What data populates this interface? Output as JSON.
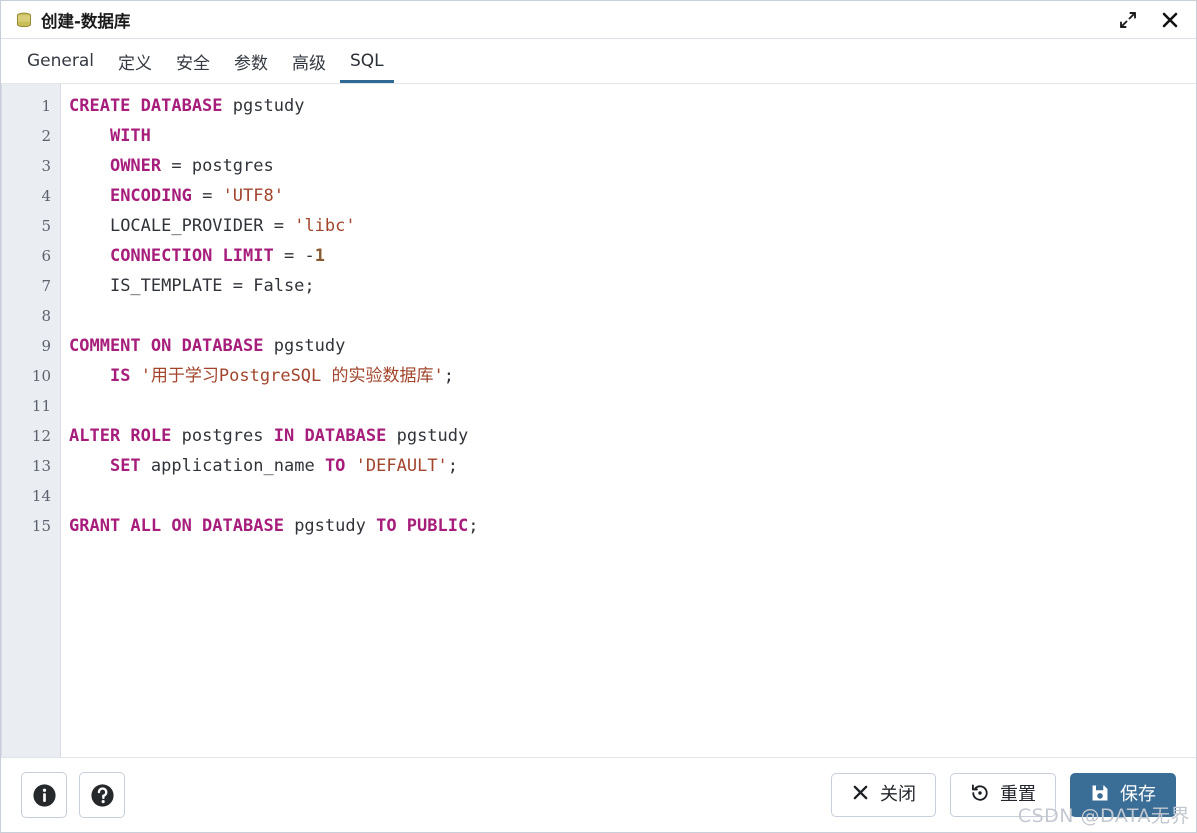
{
  "window": {
    "title": "创建-数据库",
    "icon": "database-icon",
    "maximize_icon": "expand-diagonal-icon",
    "close_icon": "close-x-icon"
  },
  "tabs": [
    {
      "label": "General",
      "active": false
    },
    {
      "label": "定义",
      "active": false
    },
    {
      "label": "安全",
      "active": false
    },
    {
      "label": "参数",
      "active": false
    },
    {
      "label": "高级",
      "active": false
    },
    {
      "label": "SQL",
      "active": true
    }
  ],
  "editor": {
    "language": "sql",
    "line_count": 15,
    "line_numbers": [
      "1",
      "2",
      "3",
      "4",
      "5",
      "6",
      "7",
      "8",
      "9",
      "10",
      "11",
      "12",
      "13",
      "14",
      "15"
    ],
    "plain_text": "CREATE DATABASE pgstudy\n    WITH\n    OWNER = postgres\n    ENCODING = 'UTF8'\n    LOCALE_PROVIDER = 'libc'\n    CONNECTION LIMIT = -1\n    IS_TEMPLATE = False;\n\nCOMMENT ON DATABASE pgstudy\n    IS '用于学习PostgreSQL 的实验数据库';\n\nALTER ROLE postgres IN DATABASE pgstudy\n    SET application_name TO 'DEFAULT';\n\nGRANT ALL ON DATABASE pgstudy TO PUBLIC;",
    "lines": [
      {
        "n": "1",
        "tokens": [
          {
            "t": "CREATE DATABASE",
            "c": "kw"
          },
          {
            "t": " ",
            "c": "op"
          },
          {
            "t": "pgstudy",
            "c": "id"
          }
        ]
      },
      {
        "n": "2",
        "tokens": [
          {
            "t": "    ",
            "c": "op"
          },
          {
            "t": "WITH",
            "c": "kw"
          }
        ]
      },
      {
        "n": "3",
        "tokens": [
          {
            "t": "    ",
            "c": "op"
          },
          {
            "t": "OWNER",
            "c": "kw"
          },
          {
            "t": " = ",
            "c": "op"
          },
          {
            "t": "postgres",
            "c": "id"
          }
        ]
      },
      {
        "n": "4",
        "tokens": [
          {
            "t": "    ",
            "c": "op"
          },
          {
            "t": "ENCODING",
            "c": "kw"
          },
          {
            "t": " = ",
            "c": "op"
          },
          {
            "t": "'UTF8'",
            "c": "str"
          }
        ]
      },
      {
        "n": "5",
        "tokens": [
          {
            "t": "    ",
            "c": "op"
          },
          {
            "t": "LOCALE_PROVIDER",
            "c": "id"
          },
          {
            "t": " = ",
            "c": "op"
          },
          {
            "t": "'libc'",
            "c": "str"
          }
        ]
      },
      {
        "n": "6",
        "tokens": [
          {
            "t": "    ",
            "c": "op"
          },
          {
            "t": "CONNECTION LIMIT",
            "c": "kw"
          },
          {
            "t": " = ",
            "c": "op"
          },
          {
            "t": "-",
            "c": "op"
          },
          {
            "t": "1",
            "c": "num"
          }
        ]
      },
      {
        "n": "7",
        "tokens": [
          {
            "t": "    ",
            "c": "op"
          },
          {
            "t": "IS_TEMPLATE = False;",
            "c": "id"
          }
        ]
      },
      {
        "n": "8",
        "tokens": [
          {
            "t": "",
            "c": "op"
          }
        ]
      },
      {
        "n": "9",
        "tokens": [
          {
            "t": "COMMENT ON DATABASE",
            "c": "kw"
          },
          {
            "t": " ",
            "c": "op"
          },
          {
            "t": "pgstudy",
            "c": "id"
          }
        ]
      },
      {
        "n": "10",
        "tokens": [
          {
            "t": "    ",
            "c": "op"
          },
          {
            "t": "IS",
            "c": "kw"
          },
          {
            "t": " ",
            "c": "op"
          },
          {
            "t": "'用于学习PostgreSQL 的实验数据库'",
            "c": "str"
          },
          {
            "t": ";",
            "c": "op"
          }
        ]
      },
      {
        "n": "11",
        "tokens": [
          {
            "t": "",
            "c": "op"
          }
        ]
      },
      {
        "n": "12",
        "tokens": [
          {
            "t": "ALTER ROLE",
            "c": "kw"
          },
          {
            "t": " ",
            "c": "op"
          },
          {
            "t": "postgres",
            "c": "id"
          },
          {
            "t": " ",
            "c": "op"
          },
          {
            "t": "IN DATABASE",
            "c": "kw"
          },
          {
            "t": " ",
            "c": "op"
          },
          {
            "t": "pgstudy",
            "c": "id"
          }
        ]
      },
      {
        "n": "13",
        "tokens": [
          {
            "t": "    ",
            "c": "op"
          },
          {
            "t": "SET",
            "c": "kw"
          },
          {
            "t": " ",
            "c": "op"
          },
          {
            "t": "application_name",
            "c": "id"
          },
          {
            "t": " ",
            "c": "op"
          },
          {
            "t": "TO",
            "c": "kw"
          },
          {
            "t": " ",
            "c": "op"
          },
          {
            "t": "'DEFAULT'",
            "c": "str"
          },
          {
            "t": ";",
            "c": "op"
          }
        ]
      },
      {
        "n": "14",
        "tokens": [
          {
            "t": "",
            "c": "op"
          }
        ]
      },
      {
        "n": "15",
        "tokens": [
          {
            "t": "GRANT ALL ON DATABASE",
            "c": "kw"
          },
          {
            "t": " ",
            "c": "op"
          },
          {
            "t": "pgstudy",
            "c": "id"
          },
          {
            "t": " ",
            "c": "op"
          },
          {
            "t": "TO PUBLIC",
            "c": "kw"
          },
          {
            "t": ";",
            "c": "op"
          }
        ]
      }
    ]
  },
  "footer": {
    "info_icon": "info-circle-icon",
    "help_icon": "help-circle-icon",
    "close": {
      "label": "关闭",
      "icon": "close-x-icon"
    },
    "reset": {
      "label": "重置",
      "icon": "reset-undo-icon"
    },
    "save": {
      "label": "保存",
      "icon": "save-floppy-icon"
    }
  },
  "watermark": "CSDN @DATA无界",
  "colors": {
    "accent": "#3a6e97",
    "tab_underline": "#2f6a95",
    "keyword": "#a71d7b",
    "string": "#a2452c",
    "number": "#8a5a30",
    "identifier": "#303339",
    "gutter_bg": "#eaedf2",
    "db_icon": "#b5a642"
  }
}
